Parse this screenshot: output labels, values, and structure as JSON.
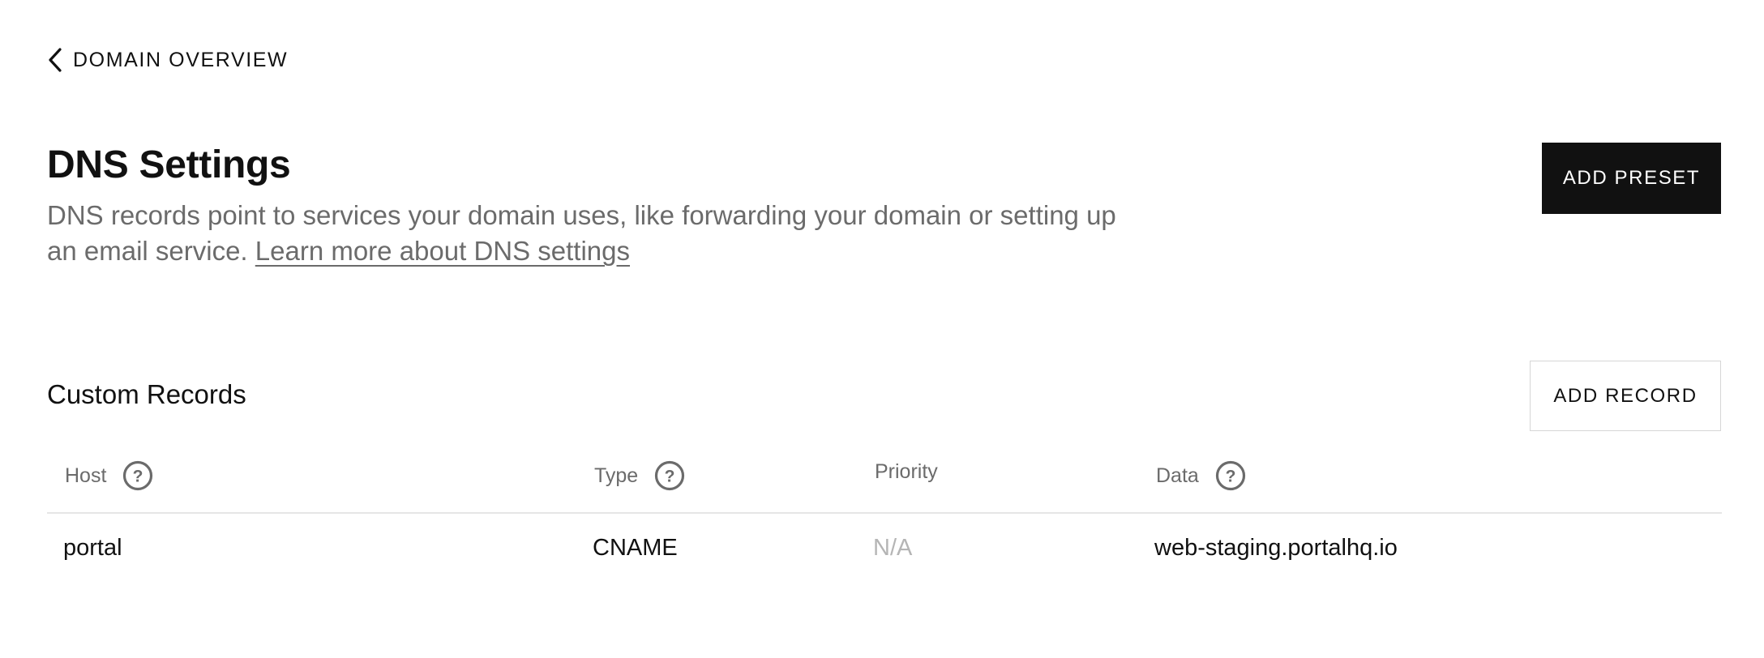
{
  "nav": {
    "back_label": "DOMAIN OVERVIEW"
  },
  "header": {
    "title": "DNS Settings",
    "description": "DNS records point to services your domain uses, like forwarding your domain or setting up an email service. ",
    "learn_more_link": "Learn more about DNS settings",
    "add_preset_label": "ADD PRESET"
  },
  "custom_records": {
    "title": "Custom Records",
    "add_record_label": "ADD RECORD",
    "columns": [
      {
        "label": "Host",
        "help_icon": "question-circle-icon"
      },
      {
        "label": "Type",
        "help_icon": "question-circle-icon"
      },
      {
        "label": "Priority"
      },
      {
        "label": "Data",
        "help_icon": "question-circle-icon"
      }
    ],
    "rows": [
      {
        "host": "portal",
        "type": "CNAME",
        "priority": "N/A",
        "data": "web-staging.portalhq.io"
      }
    ]
  },
  "colors": {
    "primary_button_bg": "#111111",
    "muted_text": "#6b6b6b",
    "placeholder_text": "#b5b5b5"
  }
}
